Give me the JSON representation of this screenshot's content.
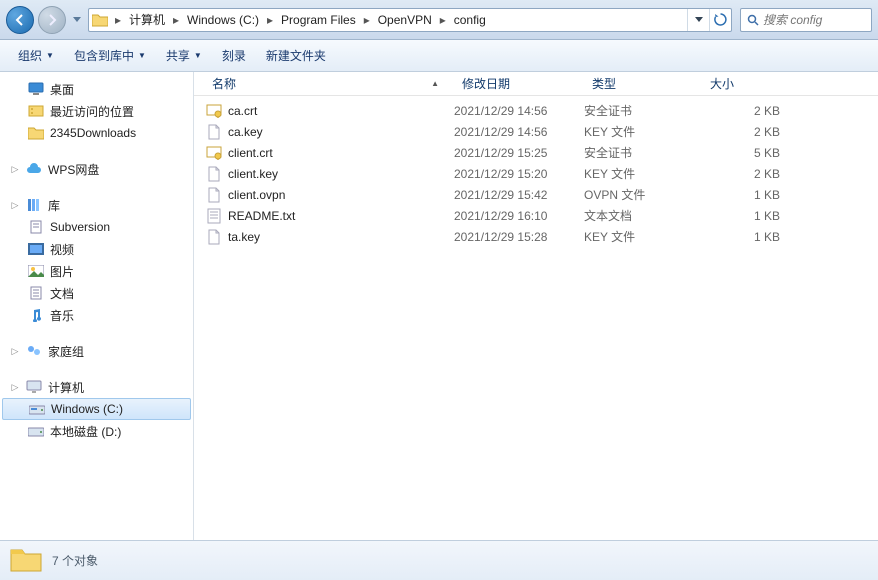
{
  "nav": {
    "back_enabled": true,
    "forward_enabled": false
  },
  "breadcrumbs": [
    {
      "label": "计算机"
    },
    {
      "label": "Windows (C:)"
    },
    {
      "label": "Program Files"
    },
    {
      "label": "OpenVPN"
    },
    {
      "label": "config"
    }
  ],
  "search": {
    "placeholder": "搜索 config"
  },
  "toolbar": {
    "organize": "组织",
    "include": "包含到库中",
    "share": "共享",
    "burn": "刻录",
    "newfolder": "新建文件夹"
  },
  "sidebar": {
    "desktop": "桌面",
    "recent": "最近访问的位置",
    "downloads": "2345Downloads",
    "wps": "WPS网盘",
    "libraries": "库",
    "subversion": "Subversion",
    "videos": "视频",
    "pictures": "图片",
    "documents": "文档",
    "music": "音乐",
    "homegroup": "家庭组",
    "computer": "计算机",
    "cdrive": "Windows (C:)",
    "ddrive": "本地磁盘 (D:)"
  },
  "columns": {
    "name": "名称",
    "date": "修改日期",
    "type": "类型",
    "size": "大小"
  },
  "files": [
    {
      "icon": "cert",
      "name": "ca.crt",
      "date": "2021/12/29 14:56",
      "type": "安全证书",
      "size": "2 KB"
    },
    {
      "icon": "file",
      "name": "ca.key",
      "date": "2021/12/29 14:56",
      "type": "KEY 文件",
      "size": "2 KB"
    },
    {
      "icon": "cert",
      "name": "client.crt",
      "date": "2021/12/29 15:25",
      "type": "安全证书",
      "size": "5 KB"
    },
    {
      "icon": "file",
      "name": "client.key",
      "date": "2021/12/29 15:20",
      "type": "KEY 文件",
      "size": "2 KB"
    },
    {
      "icon": "file",
      "name": "client.ovpn",
      "date": "2021/12/29 15:42",
      "type": "OVPN 文件",
      "size": "1 KB"
    },
    {
      "icon": "txt",
      "name": "README.txt",
      "date": "2021/12/29 16:10",
      "type": "文本文档",
      "size": "1 KB"
    },
    {
      "icon": "file",
      "name": "ta.key",
      "date": "2021/12/29 15:28",
      "type": "KEY 文件",
      "size": "1 KB"
    }
  ],
  "status": {
    "count_text": "7 个对象"
  }
}
